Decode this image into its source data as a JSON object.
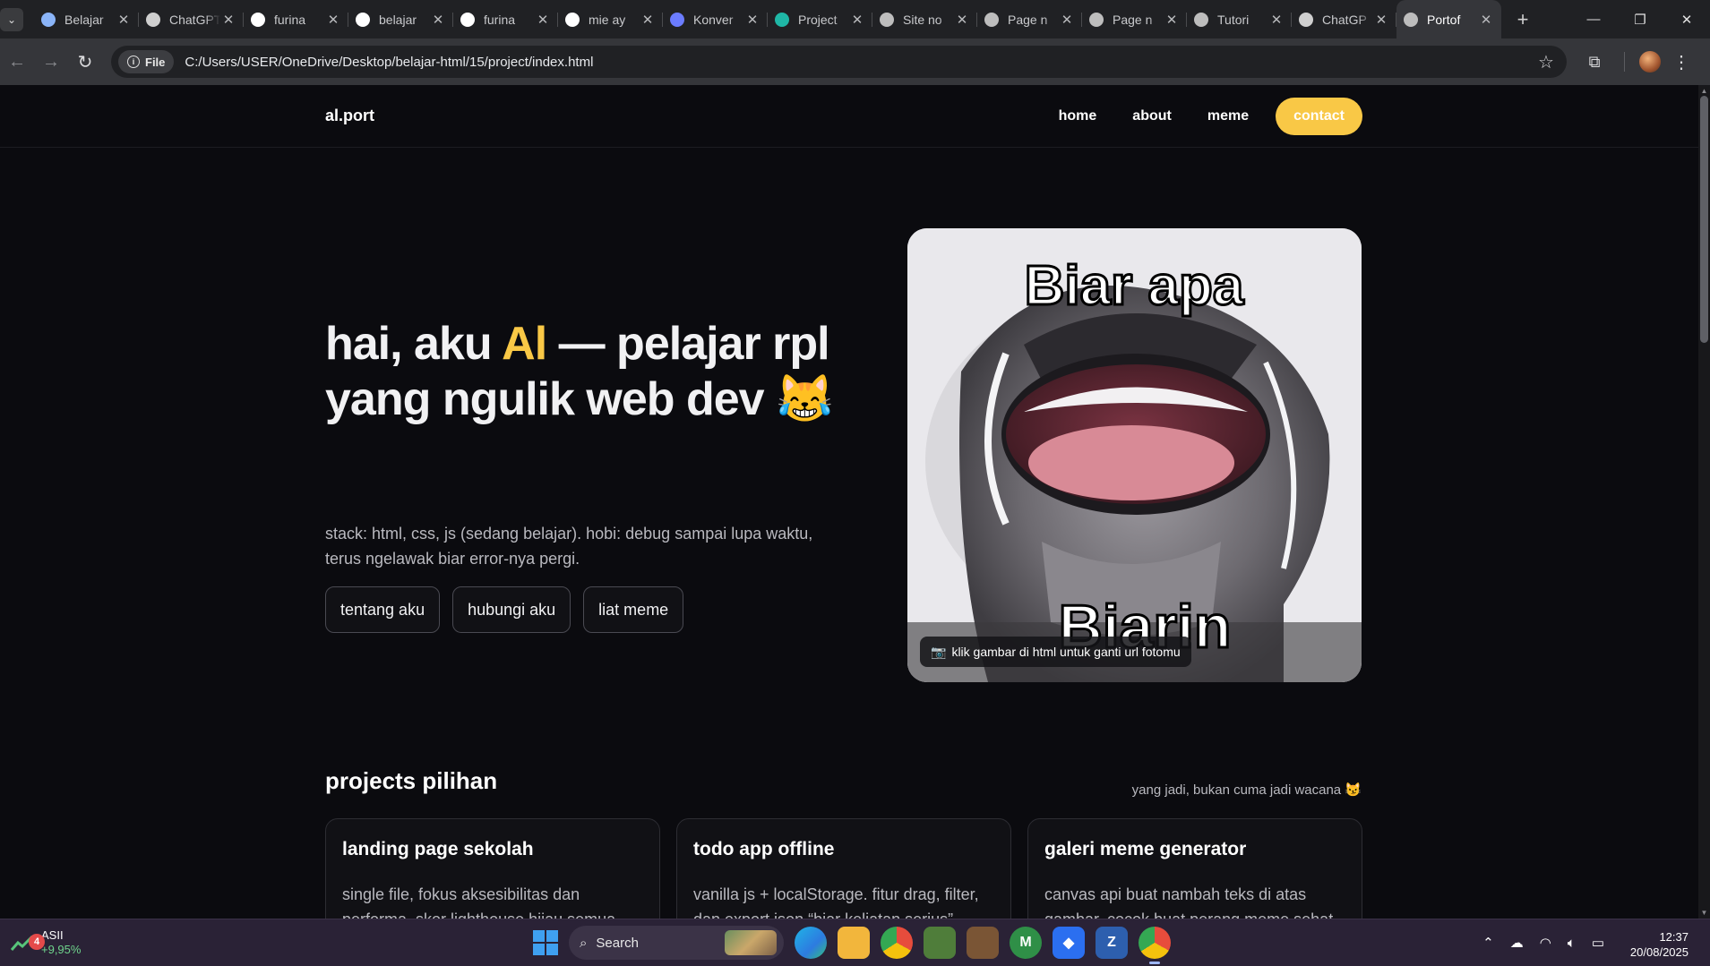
{
  "browser": {
    "tabs": [
      {
        "label": "Belajar",
        "favicon": "chrome-like-icon",
        "color": "#8ab4f8"
      },
      {
        "label": "ChatGPT",
        "favicon": "openai-icon",
        "color": "#cfcfcf"
      },
      {
        "label": "furina",
        "favicon": "google-icon",
        "color": "#ffffff"
      },
      {
        "label": "belajar",
        "favicon": "github-icon",
        "color": "#ffffff"
      },
      {
        "label": "furina",
        "favicon": "google-icon",
        "color": "#ffffff"
      },
      {
        "label": "mie ay",
        "favicon": "google-icon",
        "color": "#ffffff"
      },
      {
        "label": "Konver",
        "favicon": "convert-icon",
        "color": "#6b7cff"
      },
      {
        "label": "Project",
        "favicon": "diamond-icon",
        "color": "#1fb7a6"
      },
      {
        "label": "Site no",
        "favicon": "globe-icon",
        "color": "#bdbdbd"
      },
      {
        "label": "Page n",
        "favicon": "globe-icon",
        "color": "#bdbdbd"
      },
      {
        "label": "Page n",
        "favicon": "globe-icon",
        "color": "#bdbdbd"
      },
      {
        "label": "Tutori",
        "favicon": "globe-icon",
        "color": "#bdbdbd"
      },
      {
        "label": "ChatGP",
        "favicon": "openai-icon",
        "color": "#cfcfcf"
      },
      {
        "label": "Portof",
        "favicon": "globe-icon",
        "color": "#bdbdbd",
        "active": true
      }
    ],
    "address": {
      "chip": "File",
      "url": "C:/Users/USER/OneDrive/Desktop/belajar-html/15/project/index.html"
    }
  },
  "site": {
    "logo": "al.port",
    "nav": {
      "home": "home",
      "about": "about",
      "meme": "meme",
      "contact": "contact"
    },
    "hero": {
      "title_before": "hai, aku ",
      "title_accent": "Al",
      "title_after": " — pelajar rpl yang ngulik web dev ",
      "title_emoji": "😹",
      "subtitle": "stack: html, css, js (sedang belajar). hobi: debug sampai lupa waktu, terus ngelawak biar error-nya pergi.",
      "buttons": {
        "about": "tentang aku",
        "contact": "hubungi aku",
        "meme": "liat meme"
      }
    },
    "meme": {
      "top_text": "Biar apa",
      "bottom_text": "Biarin",
      "caption_icon": "📷",
      "caption": "klik gambar di html untuk ganti url fotomu"
    },
    "projects": {
      "title": "projects pilihan",
      "note": "yang jadi, bukan cuma jadi wacana 😼",
      "cards": [
        {
          "title": "landing page sekolah",
          "desc": "single file, fokus aksesibilitas dan performa. skor lighthouse hijau semua (bukan iri"
        },
        {
          "title": "todo app offline",
          "desc": "vanilla js + localStorage. fitur drag, filter, dan export json “biar keliatan serius”"
        },
        {
          "title": "galeri meme generator",
          "desc": "canvas api buat nambah teks di atas gambar, cocok buat perang meme sehat"
        }
      ]
    }
  },
  "taskbar": {
    "stock": {
      "name": "ASII",
      "change": "+9,95%",
      "badge": "4"
    },
    "search_placeholder": "Search",
    "time": "12:37",
    "date": "20/08/2025"
  },
  "colors": {
    "accent": "#f9c846",
    "background": "#0b0b0f",
    "card_border": "#2d2d33"
  }
}
